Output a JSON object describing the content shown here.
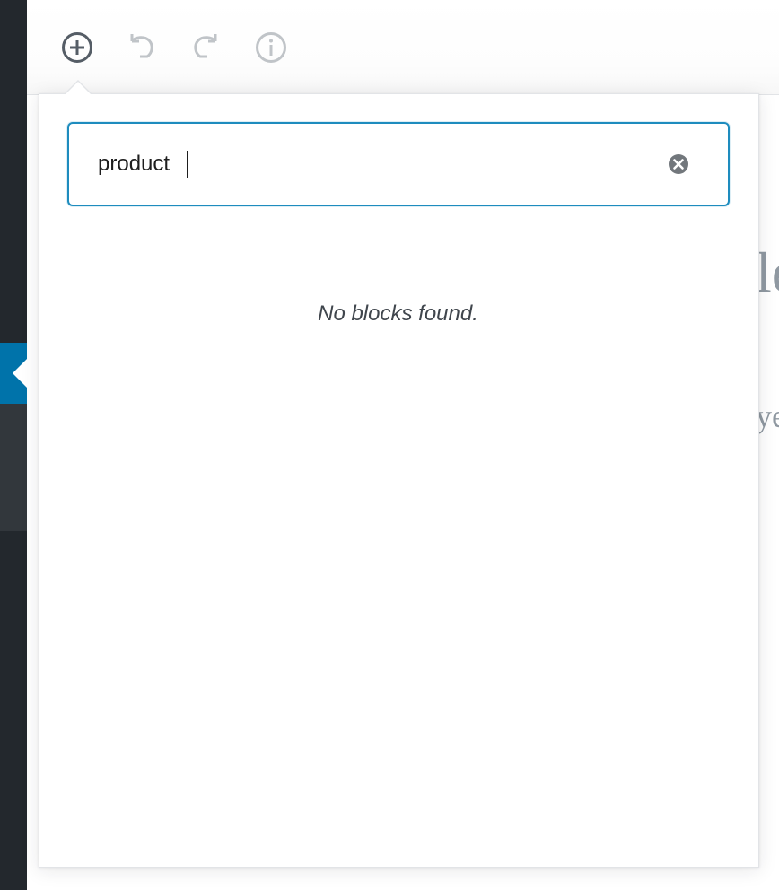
{
  "admin_sidebar": {
    "active_color": "#0073aa",
    "background": "#23282d"
  },
  "toolbar": {
    "add_block_icon": "plus-circle-icon",
    "undo_icon": "undo-icon",
    "redo_icon": "redo-icon",
    "info_icon": "info-icon"
  },
  "inserter": {
    "search_value": "product",
    "clear_icon": "clear-circle-icon",
    "no_results_text": "No blocks found.",
    "focus_color": "#1e8cbe"
  },
  "background_text": {
    "heading_fragment": "le",
    "paragraph_fragment": "ye"
  }
}
